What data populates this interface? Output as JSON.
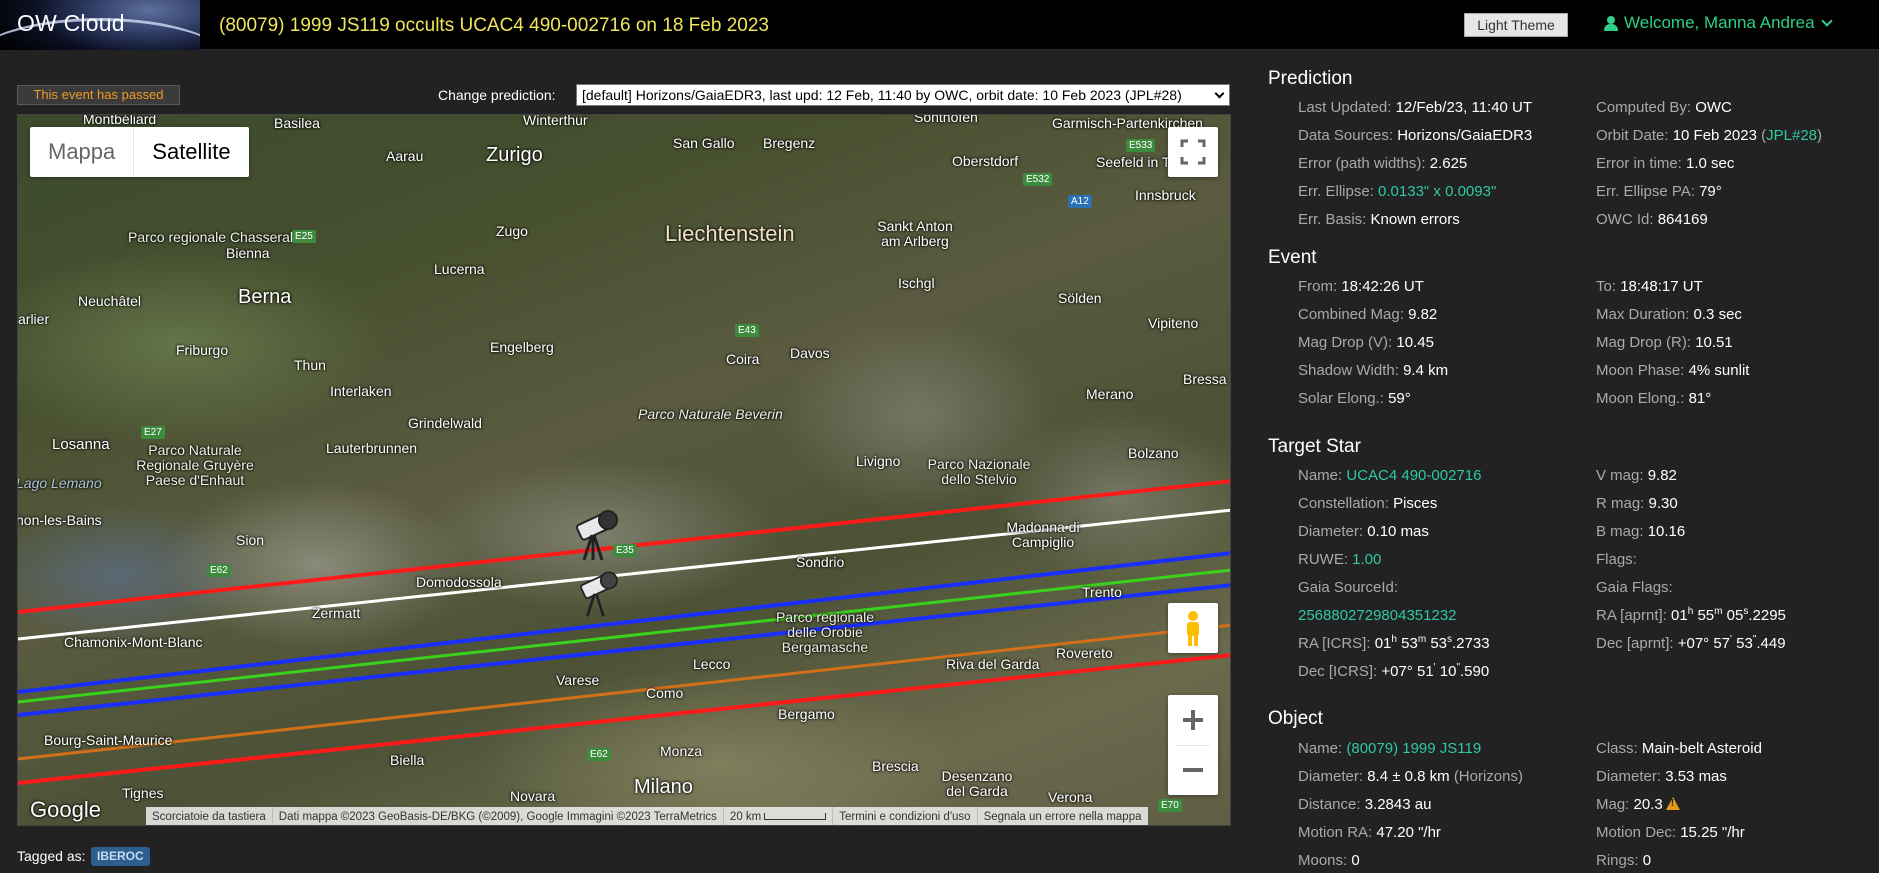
{
  "header": {
    "brand": "OW Cloud",
    "title": "(80079) 1999 JS119 occults UCAC4 490-002716 on 18 Feb 2023",
    "theme_button": "Light Theme",
    "welcome": "Welcome, Manna Andrea"
  },
  "status": {
    "passed": "This event has passed"
  },
  "prediction_selector": {
    "label": "Change prediction:",
    "selected": "[default] Horizons/GaiaEDR3, last upd: 12 Feb, 11:40 by OWC, orbit date: 10 Feb 2023 (JPL#28)"
  },
  "map": {
    "type_map": "Mappa",
    "type_satellite": "Satellite",
    "google": "Google",
    "attribution": {
      "shortcuts": "Scorciatoie da tastiera",
      "data": "Dati mappa ©2023 GeoBasis-DE/BKG (©2009), Google Immagini ©2023 TerraMetrics",
      "scale": "20 km",
      "terms": "Termini e condizioni d'uso",
      "report": "Segnala un errore nella mappa"
    },
    "labels": {
      "montbeliard": "Montbéliard",
      "basilea": "Basilea",
      "winterthur": "Winterthur",
      "sonthofen": "Sonthofen",
      "garmisch": "Garmisch-Partenkirchen",
      "aarau": "Aarau",
      "zurigo": "Zurigo",
      "sangallo": "San Gallo",
      "bregenz": "Bregenz",
      "oberstdorf": "Oberstdorf",
      "seefeld": "Seefeld in Tirol",
      "innsbruck": "Innsbruck",
      "parco_chasseral": "Parco regionale Chasseral",
      "bienna": "Bienna",
      "zugo": "Zugo",
      "liechtenstein": "Liechtenstein",
      "sanktanton": "Sankt Anton am Arlberg",
      "neuchatel": "Neuchâtel",
      "berna": "Berna",
      "lucerna": "Lucerna",
      "ischgl": "Ischgl",
      "solden": "Sölden",
      "arlier": "arlier",
      "vipiteno": "Vipiteno",
      "friburgo": "Friburgo",
      "engelberg": "Engelberg",
      "coira": "Coira",
      "davos": "Davos",
      "thun": "Thun",
      "interlaken": "Interlaken",
      "merano": "Merano",
      "bressa": "Bressa",
      "parco_beverin": "Parco Naturale Beverin",
      "grindelwald": "Grindelwald",
      "losanna": "Losanna",
      "parco_gruyere": "Parco Naturale Regionale Gruyère Paese d'Enhaut",
      "lauterbrunnen": "Lauterbrunnen",
      "livigno": "Livigno",
      "parco_stelvio": "Parco Nazionale dello Stelvio",
      "bolzano": "Bolzano",
      "lago_lemano": "Lago Lemano",
      "thonon": "hon-les-Bains",
      "sion": "Sion",
      "madonna": "Madonna di Campiglio",
      "domodossola": "Domodossola",
      "sondrio": "Sondrio",
      "zermatt": "Zermatt",
      "trento": "Trento",
      "chamonix": "Chamonix-Mont-Blanc",
      "parco_orobie": "Parco regionale delle Orobie Bergamasche",
      "lecco": "Lecco",
      "rivadelgarda": "Riva del Garda",
      "rovereto": "Rovereto",
      "varese": "Varese",
      "como": "Como",
      "bourg": "Bourg-Saint-Maurice",
      "bergamo": "Bergamo",
      "biella": "Biella",
      "monza": "Monza",
      "brescia": "Brescia",
      "desenzano": "Desenzano del Garda",
      "tignes": "Tignes",
      "novara": "Novara",
      "milano": "Milano",
      "verona": "Verona"
    },
    "roads": {
      "e533": "E533",
      "e532": "E532",
      "a12": "A12",
      "e25": "E25",
      "e43": "E43",
      "e27": "E27",
      "e35": "E35",
      "e62a": "E62",
      "e62b": "E62",
      "e70": "E70"
    }
  },
  "tags": {
    "label": "Tagged as:",
    "items": [
      "IBEROC"
    ]
  },
  "prediction": {
    "title": "Prediction",
    "last_updated_k": "Last Updated:",
    "last_updated_v": "12/Feb/23, 11:40 UT",
    "computed_by_k": "Computed By:",
    "computed_by_v": "OWC",
    "data_sources_k": "Data Sources:",
    "data_sources_v": "Horizons/GaiaEDR3",
    "orbit_date_k": "Orbit Date:",
    "orbit_date_v": "10 Feb 2023",
    "orbit_link": "JPL#28",
    "error_path_k": "Error (path widths):",
    "error_path_v": "2.625",
    "error_time_k": "Error in time:",
    "error_time_v": "1.0 sec",
    "err_ellipse_k": "Err. Ellipse:",
    "err_ellipse_v": "0.0133\" x 0.0093\"",
    "err_ellipse_pa_k": "Err. Ellipse PA:",
    "err_ellipse_pa_v": "79°",
    "err_basis_k": "Err. Basis:",
    "err_basis_v": "Known errors",
    "owc_id_k": "OWC Id:",
    "owc_id_v": "864169"
  },
  "event": {
    "title": "Event",
    "from_k": "From:",
    "from_v": "18:42:26 UT",
    "to_k": "To:",
    "to_v": "18:48:17 UT",
    "combined_mag_k": "Combined Mag:",
    "combined_mag_v": "9.82",
    "max_duration_k": "Max Duration:",
    "max_duration_v": "0.3 sec",
    "mag_drop_v_k": "Mag Drop (V):",
    "mag_drop_v_v": "10.45",
    "mag_drop_r_k": "Mag Drop (R):",
    "mag_drop_r_v": "10.51",
    "shadow_width_k": "Shadow Width:",
    "shadow_width_v": "9.4 km",
    "moon_phase_k": "Moon Phase:",
    "moon_phase_v": "4%",
    "moon_phase_suffix": "sunlit",
    "solar_elong_k": "Solar Elong.:",
    "solar_elong_v": "59°",
    "moon_elong_k": "Moon Elong.:",
    "moon_elong_v": "81°"
  },
  "target_star": {
    "title": "Target Star",
    "name_k": "Name:",
    "name_v": "UCAC4 490-002716",
    "vmag_k": "V mag:",
    "vmag_v": "9.82",
    "constellation_k": "Constellation:",
    "constellation_v": "Pisces",
    "rmag_k": "R mag:",
    "rmag_v": "9.30",
    "diameter_k": "Diameter:",
    "diameter_v": "0.10 mas",
    "bmag_k": "B mag:",
    "bmag_v": "10.16",
    "ruwe_k": "RUWE:",
    "ruwe_v": "1.00",
    "flags_k": "Flags:",
    "gaia_sourceid_k": "Gaia SourceId:",
    "gaia_sourceid_v": "2568802729804351232",
    "gaia_flags_k": "Gaia Flags:",
    "ra_aprnt_k": "RA [aprnt]:",
    "ra_aprnt": {
      "h": "01",
      "m": "55",
      "s": "05",
      "frac": ".2295"
    },
    "ra_icrs_k": "RA [ICRS]:",
    "ra_icrs": {
      "h": "01",
      "m": "53",
      "s": "53",
      "frac": ".2733"
    },
    "dec_aprnt_k": "Dec [aprnt]:",
    "dec_aprnt": {
      "deg": "+07°",
      "am": "57",
      "as": "53",
      "frac": ".449"
    },
    "dec_icrs_k": "Dec [ICRS]:",
    "dec_icrs": {
      "deg": "+07°",
      "am": "51",
      "as": "10",
      "frac": ".590"
    }
  },
  "object": {
    "title": "Object",
    "name_k": "Name:",
    "name_v": "(80079) 1999 JS119",
    "class_k": "Class:",
    "class_v": "Main-belt Asteroid",
    "diameter_k": "Diameter:",
    "diameter_v": "8.4 ± 0.8 km",
    "diameter_src": "(Horizons)",
    "diameter_mas_k": "Diameter:",
    "diameter_mas_v": "3.53 mas",
    "distance_k": "Distance:",
    "distance_v": "3.2843 au",
    "mag_k": "Mag:",
    "mag_v": "20.3",
    "motion_ra_k": "Motion RA:",
    "motion_ra_v": "47.20 \"/hr",
    "motion_dec_k": "Motion Dec:",
    "motion_dec_v": "15.25 \"/hr",
    "moons_k": "Moons:",
    "moons_v": "0",
    "rings_k": "Rings:",
    "rings_v": "0"
  }
}
